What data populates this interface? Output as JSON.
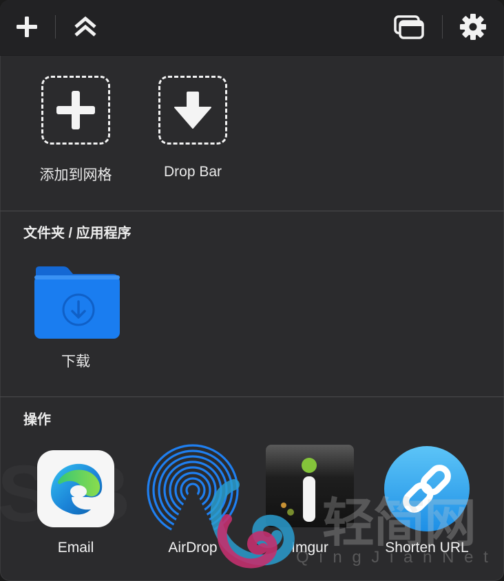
{
  "toolbar": {
    "add_icon": "plus-icon",
    "collapse_icon": "chevrons-up-icon",
    "windows_icon": "stacked-windows-icon",
    "settings_icon": "gear-icon"
  },
  "top_tiles": [
    {
      "label": "添加到网格",
      "icon": "plus-icon"
    },
    {
      "label": "Drop Bar",
      "icon": "download-arrow-icon"
    }
  ],
  "folders": {
    "title": "文件夹 / 应用程序",
    "items": [
      {
        "label": "下载",
        "icon": "folder-download-icon",
        "color": "#1a7df0"
      }
    ]
  },
  "actions": {
    "title": "操作",
    "items": [
      {
        "label": "Email",
        "icon": "edge-icon"
      },
      {
        "label": "AirDrop",
        "icon": "airdrop-icon"
      },
      {
        "label": "Imgur",
        "icon": "imgur-icon"
      },
      {
        "label": "Shorten URL",
        "icon": "link-icon"
      }
    ]
  },
  "watermark": {
    "chinese": "轻简网",
    "latin": "Q i n g J i a n N e t"
  },
  "colors": {
    "panel": "#2b2b2d",
    "toolbar": "#222224",
    "folder_blue": "#1a7df0",
    "airdrop_blue": "#1f7ff0",
    "shorten_blue": "#2ea6f2",
    "imgur_green": "#84c43a"
  }
}
